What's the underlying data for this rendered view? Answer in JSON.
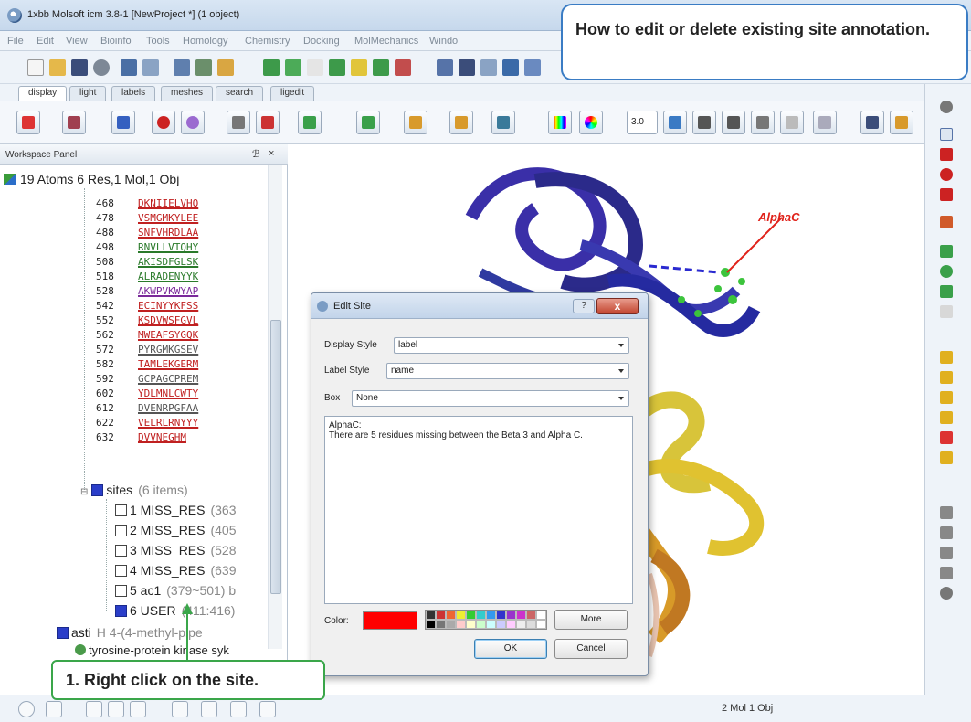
{
  "window": {
    "title": "1xbb Molsoft icm 3.8-1  [NewProject *] (1 object)"
  },
  "menu": [
    "File",
    "Edit",
    "View",
    "Bioinfo",
    "Tools",
    "Homology",
    "Chemistry",
    "Docking",
    "MolMechanics",
    "Windo"
  ],
  "tabs": [
    "display",
    "light",
    "labels",
    "meshes",
    "search",
    "ligedit"
  ],
  "workspace": {
    "header": "Workspace Panel",
    "float_glyph": "ℬ",
    "close_glyph": "×",
    "root": "19 Atoms 6 Res,1 Mol,1 Obj",
    "sequence_rows": [
      {
        "num": "468",
        "seq": "DKNIIELVHQ"
      },
      {
        "num": "478",
        "seq": "VSMGMKYLEE"
      },
      {
        "num": "488",
        "seq": "SNFVHRDLAA"
      },
      {
        "num": "498",
        "seq": "RNVLLVTQHY"
      },
      {
        "num": "508",
        "seq": "AKISDFGLSK"
      },
      {
        "num": "518",
        "seq": "ALRADENYYK"
      },
      {
        "num": "528",
        "seq": "AKWPVKWYAP"
      },
      {
        "num": "542",
        "seq": "ECINYYKFSS"
      },
      {
        "num": "552",
        "seq": "KSDVWSFGVL"
      },
      {
        "num": "562",
        "seq": "MWEAFSYGQK"
      },
      {
        "num": "572",
        "seq": "PYRGMKGSEV"
      },
      {
        "num": "582",
        "seq": "TAMLEKGERM"
      },
      {
        "num": "592",
        "seq": "GCPAGCPREM"
      },
      {
        "num": "602",
        "seq": "YDLMNLCWTY"
      },
      {
        "num": "612",
        "seq": "DVENRPGFAA"
      },
      {
        "num": "622",
        "seq": "VELRLRNYYY"
      },
      {
        "num": "632",
        "seq": "DVVNEGHM"
      }
    ],
    "sites_label": "sites",
    "sites_count": "(6 items)",
    "sites": [
      {
        "name": "1 MISS_RES",
        "meta": "(363"
      },
      {
        "name": "2 MISS_RES",
        "meta": "(405"
      },
      {
        "name": "3 MISS_RES",
        "meta": "(528"
      },
      {
        "name": "4 MISS_RES",
        "meta": "(639"
      },
      {
        "name": "5 ac1",
        "meta": "(379~501) b"
      },
      {
        "name": "6 USER",
        "meta": "(411:416)"
      }
    ],
    "asti_label": "asti",
    "asti_meta": "H  4-(4-methyl-pipe",
    "kinase_label": "tyrosine-protein kinase syk"
  },
  "dialog": {
    "title": "Edit Site",
    "help_label": "?",
    "close_label": "x",
    "display_style_label": "Display Style",
    "display_style_value": "label",
    "label_style_label": "Label Style",
    "label_style_value": "name",
    "box_label": "Box",
    "box_value": "None",
    "text_line1": "AlphaC:",
    "text_line2": "There are 5 residues missing between the Beta 3 and Alpha C.",
    "color_label": "Color:",
    "color_value": "#ff0000",
    "more_button": "More",
    "ok_button": "OK",
    "cancel_button": "Cancel"
  },
  "viewer": {
    "annotation": "AlphaC"
  },
  "toolbar2": {
    "zoom_value": "3.0"
  },
  "status": {
    "text": "2 Mol 1 Obj"
  },
  "callouts": {
    "top": "How to edit or delete existing site annotation.",
    "bottom": "1. Right click on the site."
  }
}
